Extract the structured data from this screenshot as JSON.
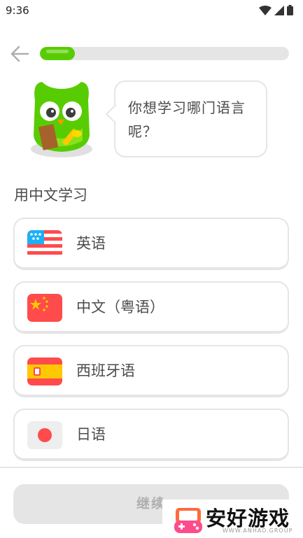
{
  "status_bar": {
    "time": "9:36"
  },
  "progress": {
    "value_fraction": 0.14
  },
  "speech_bubble": {
    "text": "你想学习哪门语言呢？"
  },
  "section": {
    "title": "用中文学习"
  },
  "languages": [
    {
      "label": "英语",
      "flag": "usa-flag-icon"
    },
    {
      "label": "中文（粤语）",
      "flag": "china-flag-icon"
    },
    {
      "label": "西班牙语",
      "flag": "spain-flag-icon"
    },
    {
      "label": "日语",
      "flag": "japan-flag-icon"
    }
  ],
  "continue_button": {
    "label": "继续"
  },
  "watermark": {
    "text": "安好游戏",
    "sub": "WWW.ANHAO.GROUP"
  },
  "colors": {
    "accent": "#58cc02",
    "border": "#e5e5e5",
    "disabled_text": "#afafaf"
  }
}
